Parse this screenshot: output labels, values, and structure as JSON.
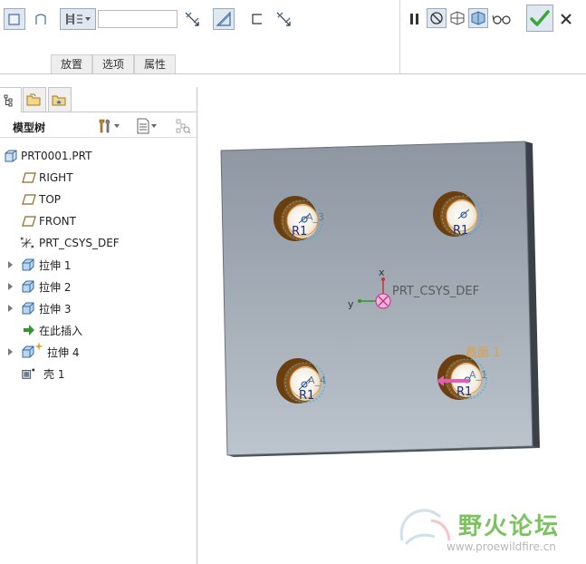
{
  "dashboard": {
    "depth_value": "",
    "tabs": [
      "放置",
      "选项",
      "属性"
    ]
  },
  "model_tree": {
    "title": "模型树",
    "items": [
      {
        "label": "PRT0001.PRT",
        "icon": "part-icon",
        "expandable": false
      },
      {
        "label": "RIGHT",
        "icon": "datum-plane-icon",
        "expandable": false
      },
      {
        "label": "TOP",
        "icon": "datum-plane-icon",
        "expandable": false
      },
      {
        "label": "FRONT",
        "icon": "datum-plane-icon",
        "expandable": false
      },
      {
        "label": "PRT_CSYS_DEF",
        "icon": "csys-icon",
        "expandable": false
      },
      {
        "label": "拉伸 1",
        "icon": "extrude-icon",
        "expandable": true
      },
      {
        "label": "拉伸 2",
        "icon": "extrude-icon",
        "expandable": true
      },
      {
        "label": "拉伸 3",
        "icon": "extrude-icon",
        "expandable": true
      },
      {
        "label": "在此插入",
        "icon": "insert-here-arrow-icon",
        "expandable": false
      },
      {
        "label": "拉伸 4",
        "icon": "extrude-icon",
        "expandable": true
      },
      {
        "label": "壳 1",
        "icon": "shell-icon",
        "expandable": false
      }
    ]
  },
  "viewport": {
    "csys_label": "PRT_CSYS_DEF",
    "axis_x": "x",
    "axis_y": "y",
    "section_label": "截面 1",
    "hole_labels": [
      "R1",
      "R1",
      "R1",
      "R1"
    ],
    "hole_tags": [
      "3",
      "",
      "4",
      "1"
    ],
    "hole_tag_prefix": "A_"
  },
  "watermark": {
    "text": "野火论坛",
    "url": "www.proewildfire.cn"
  },
  "colors": {
    "plate_top": "#8e97a2",
    "plate_bottom": "#b8c0ca",
    "hole_ring": "#6b3e10",
    "accent_check": "#4cae4c",
    "csys": "#e060b0",
    "section_label": "#e0a040"
  }
}
